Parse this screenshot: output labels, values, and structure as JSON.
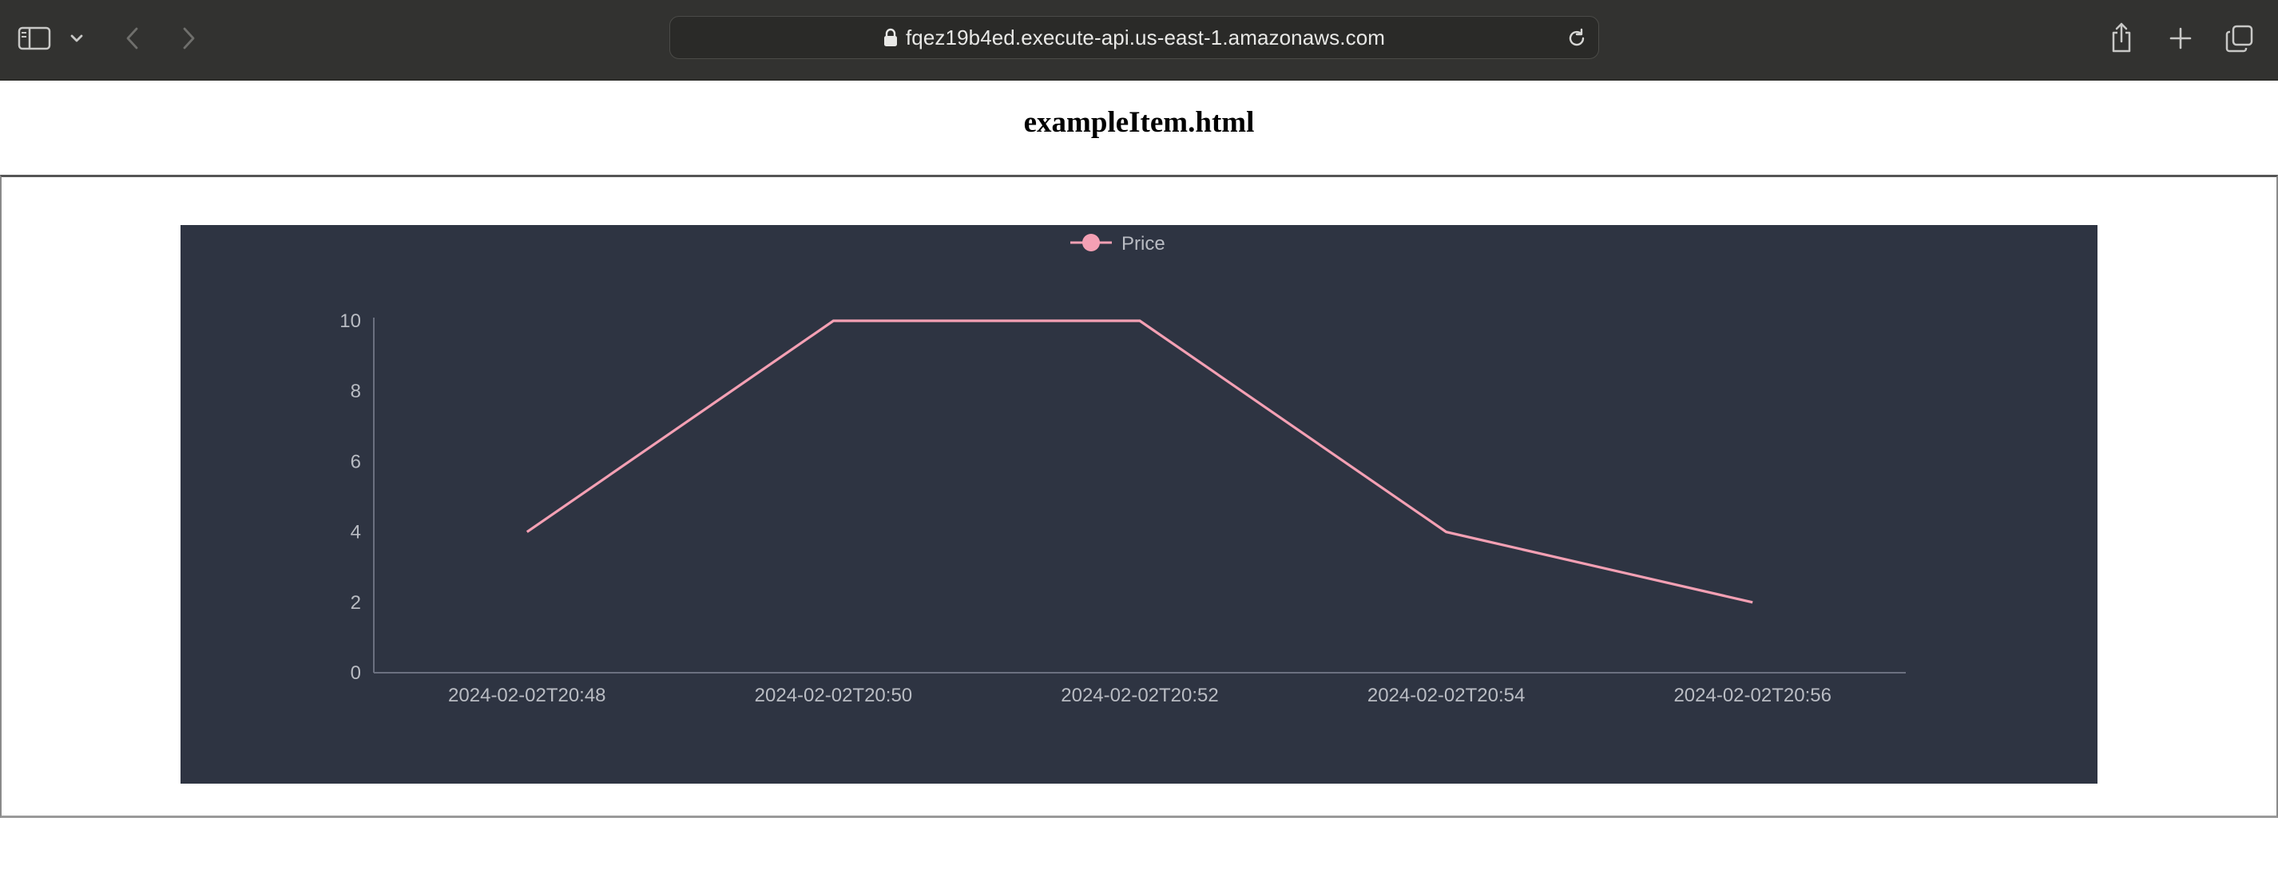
{
  "browser": {
    "url": "fqez19b4ed.execute-api.us-east-1.amazonaws.com",
    "icons": {
      "sidebar": "sidebar-icon",
      "chevron": "chevron-down-icon",
      "back": "back-arrow-icon",
      "forward": "forward-arrow-icon",
      "lock": "lock-icon",
      "reload": "reload-icon",
      "share": "share-icon",
      "new_tab": "plus-icon",
      "tabs": "tabs-overview-icon"
    }
  },
  "page": {
    "title": "exampleItem.html"
  },
  "chart_data": {
    "type": "line",
    "categories": [
      "2024-02-02T20:48",
      "2024-02-02T20:50",
      "2024-02-02T20:52",
      "2024-02-02T20:54",
      "2024-02-02T20:56"
    ],
    "series": [
      {
        "name": "Price",
        "values": [
          4,
          10,
          10,
          4,
          2
        ],
        "color": "#f4a0b4"
      }
    ],
    "yticks": [
      0,
      2,
      4,
      6,
      8,
      10
    ],
    "ylim": [
      0,
      10
    ],
    "legend_position": "top-center",
    "grid": false,
    "background": "#2e3442"
  }
}
